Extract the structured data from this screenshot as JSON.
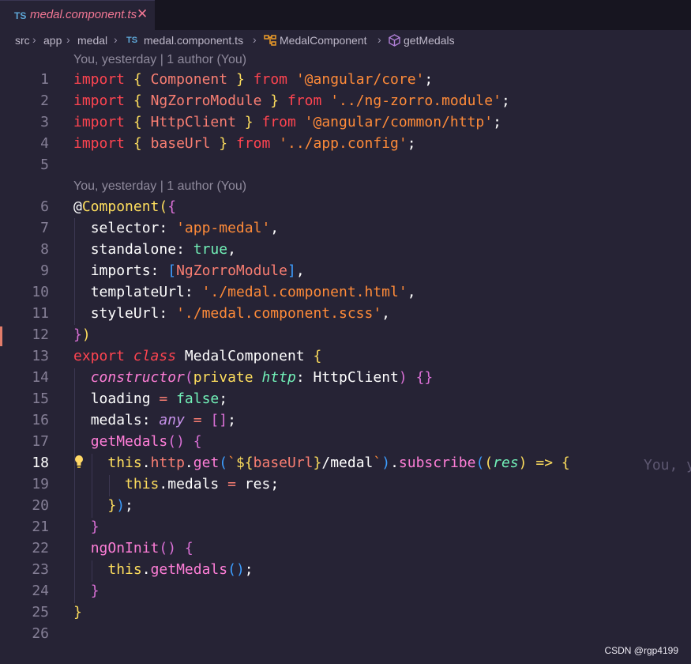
{
  "tab": {
    "lang": "TS",
    "filename": "medal.component.ts",
    "close": "✕"
  },
  "breadcrumb": {
    "src": "src",
    "app": "app",
    "medal": "medal",
    "file_icon": "TS",
    "file": "medal.component.ts",
    "class": "MedalComponent",
    "method": "getMedals"
  },
  "blame": {
    "first": "You, yesterday | 1 author (You)",
    "second": "You, yesterday | 1 author (You)",
    "inline": "You, y"
  },
  "watermark": "CSDN @rgp4199",
  "line_numbers": [
    "1",
    "2",
    "3",
    "4",
    "5",
    "6",
    "7",
    "8",
    "9",
    "10",
    "11",
    "12",
    "13",
    "14",
    "15",
    "16",
    "17",
    "18",
    "19",
    "20",
    "21",
    "22",
    "23",
    "24",
    "25",
    "26"
  ],
  "active_line": "18",
  "code": {
    "l1": [
      "import",
      "{",
      "Component",
      "}",
      "from",
      "'@angular/core'",
      ";"
    ],
    "l2": [
      "import",
      "{",
      "NgZorroModule",
      "}",
      "from",
      "'../ng-zorro.module'",
      ";"
    ],
    "l3": [
      "import",
      "{",
      "HttpClient",
      "}",
      "from",
      "'@angular/common/http'",
      ";"
    ],
    "l4": [
      "import",
      "{",
      "baseUrl",
      "}",
      "from",
      "'../app.config'",
      ";"
    ],
    "l6": [
      "@",
      "Component",
      "(",
      "{"
    ],
    "l7": [
      "selector",
      ":",
      "'app-medal'",
      ","
    ],
    "l8": [
      "standalone",
      ":",
      "true",
      ","
    ],
    "l9": [
      "imports",
      ":",
      "[",
      "NgZorroModule",
      "]",
      ","
    ],
    "l10": [
      "templateUrl",
      ":",
      "'./medal.component.html'",
      ","
    ],
    "l11": [
      "styleUrl",
      ":",
      "'./medal.component.scss'",
      ","
    ],
    "l12": [
      "}",
      ")"
    ],
    "l13": [
      "export",
      "class",
      "MedalComponent",
      "{"
    ],
    "l14": [
      "constructor",
      "(",
      "private",
      "http",
      ":",
      "HttpClient",
      ")",
      "{}"
    ],
    "l15": [
      "loading",
      "=",
      "false",
      ";"
    ],
    "l16": [
      "medals",
      ":",
      "any",
      "=",
      "[]",
      ";"
    ],
    "l17": [
      "getMedals",
      "()",
      "{"
    ],
    "l18": [
      "this",
      ".",
      "http",
      ".",
      "get",
      "(",
      "`",
      "${",
      "baseUrl",
      "}",
      "/medal",
      "`",
      ")",
      ".",
      "subscribe",
      "(",
      "(",
      "res",
      ")",
      "=>",
      "{"
    ],
    "l19": [
      "this",
      ".",
      "medals",
      "=",
      "res",
      ";"
    ],
    "l20": [
      "}",
      ")",
      ";"
    ],
    "l21": [
      "}"
    ],
    "l22": [
      "ngOnInit",
      "()",
      "{"
    ],
    "l23": [
      "this",
      ".",
      "getMedals",
      "()",
      ";"
    ],
    "l24": [
      "}"
    ],
    "l25": [
      "}"
    ]
  }
}
